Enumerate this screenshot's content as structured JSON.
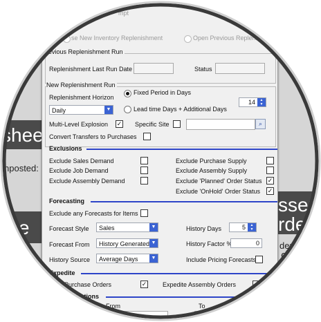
{
  "background": {
    "left_band_1": "shee",
    "left_text": "nposted:",
    "left_band_2": "ure",
    "right_band_1": "ssem",
    "right_band_2": "rde",
    "right_text_1": "ders",
    "right_text_2": "9"
  },
  "dialog": {
    "title_fragment": "mpt",
    "top_options": {
      "new_replenishment": "se New Inventory Replenishment",
      "open_previous": "Open Previous Replenis"
    },
    "previous_run": {
      "group_label": "revious Replenishment Run",
      "last_run_label": "Replenishment Last Run Date",
      "status_label": "Status"
    },
    "new_run": {
      "group_label": "New Replenishment Run",
      "horizon_label": "Replenishment Horizon",
      "fixed_period_label": "Fixed Period in Days",
      "lead_time_label": "Lead time Days + Additional Days",
      "horizon_select": "Daily",
      "days_value": "14",
      "multi_level_label": "Multi-Level Explosion",
      "multi_level_checked": true,
      "specific_site_label": "Specific Site",
      "specific_site_checked": false,
      "convert_transfers_label": "Convert Transfers to Purchases",
      "convert_transfers_checked": false
    },
    "exclusions": {
      "heading": "Exclusions",
      "items": [
        {
          "label": "Exclude Sales Demand",
          "checked": false
        },
        {
          "label": "Exclude Job Demand",
          "checked": false
        },
        {
          "label": "Exclude Assembly Demand",
          "checked": false
        },
        {
          "label": "Exclude Purchase  Supply",
          "checked": false
        },
        {
          "label": "Exclude Assembly  Supply",
          "checked": false
        },
        {
          "label": "Exclude 'Planned' Order Status",
          "checked": true
        },
        {
          "label": "Exclude 'OnHold' Order Status",
          "checked": true
        }
      ]
    },
    "forecasting": {
      "heading": "Forecasting",
      "exclude_forecasts_label": "Exclude any Forecasts for Items",
      "exclude_forecasts_checked": false,
      "style_label": "Forecast Style",
      "style_value": "Sales",
      "from_label": "Forecast From",
      "from_value": "History Generated",
      "source_label": "History Source",
      "source_value": "Average Days",
      "history_days_label": "History Days",
      "history_days_value": "5",
      "history_factor_label": "History Factor %",
      "history_factor_value": "0",
      "include_pricing_label": "Include Pricing Forecasts",
      "include_pricing_checked": false
    },
    "expedite": {
      "heading": "Expedite",
      "purchase_label": "edite Purchase Orders",
      "purchase_checked": true,
      "assembly_label": "Expedite Assembly Orders",
      "assembly_checked": true
    },
    "selection": {
      "heading": "ction Options",
      "from_label": "From",
      "to_label": "To"
    }
  },
  "colors": {
    "accent": "#2d44c8",
    "dropdown_button": "#3b63d3",
    "dialog_bg": "#f0f0f0"
  }
}
